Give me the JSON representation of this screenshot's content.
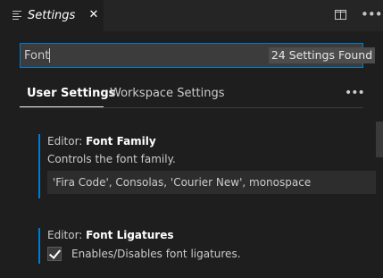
{
  "tab": {
    "title": "Settings",
    "close": "✕",
    "icon": "list-icon"
  },
  "titlebar_actions": {
    "split_icon": "split-editor-icon",
    "more_icon": "more-actions-icon"
  },
  "search": {
    "value": "Font",
    "results": "24 Settings Found"
  },
  "scope_tabs": [
    {
      "label": "User Settings",
      "active": true
    },
    {
      "label": "Workspace Settings",
      "active": false
    }
  ],
  "scope_more": "•••",
  "settings": [
    {
      "category": "Editor: ",
      "name": "Font Family",
      "description": "Controls the font family.",
      "value": "'Fira Code', Consolas, 'Courier New', monospace"
    },
    {
      "category": "Editor: ",
      "name": "Font Ligatures",
      "description": "Enables/Disables font ligatures.",
      "checked": true
    }
  ],
  "colors": {
    "accent": "#007acc",
    "background": "#1e1e1e"
  }
}
